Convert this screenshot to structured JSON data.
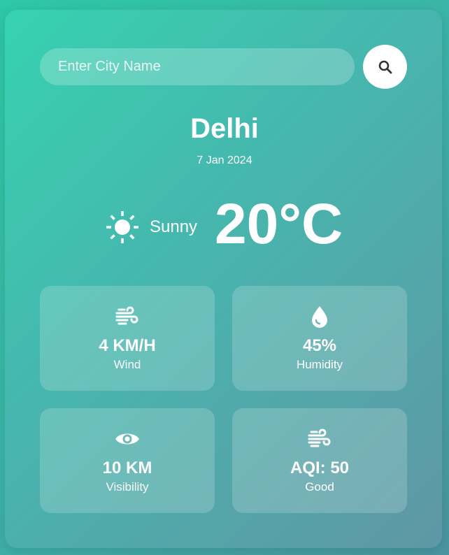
{
  "search": {
    "placeholder": "Enter City Name",
    "value": "",
    "button_icon": "search-icon"
  },
  "location": {
    "city": "Delhi",
    "date": "7 Jan 2024"
  },
  "current": {
    "condition": "Sunny",
    "condition_icon": "sun-icon",
    "temperature": "20°C"
  },
  "stats": [
    {
      "icon": "wind-icon",
      "value": "4 KM/H",
      "label": "Wind"
    },
    {
      "icon": "droplet-icon",
      "value": "45%",
      "label": "Humidity"
    },
    {
      "icon": "eye-icon",
      "value": "10 KM",
      "label": "Visibility"
    },
    {
      "icon": "wind-icon",
      "value": "AQI: 50",
      "label": "Good"
    }
  ],
  "colors": {
    "background_start": "#2dc9a6",
    "background_end": "#4a95a0",
    "text": "#ffffff",
    "button": "#ffffff",
    "icon_dark": "#333333"
  }
}
